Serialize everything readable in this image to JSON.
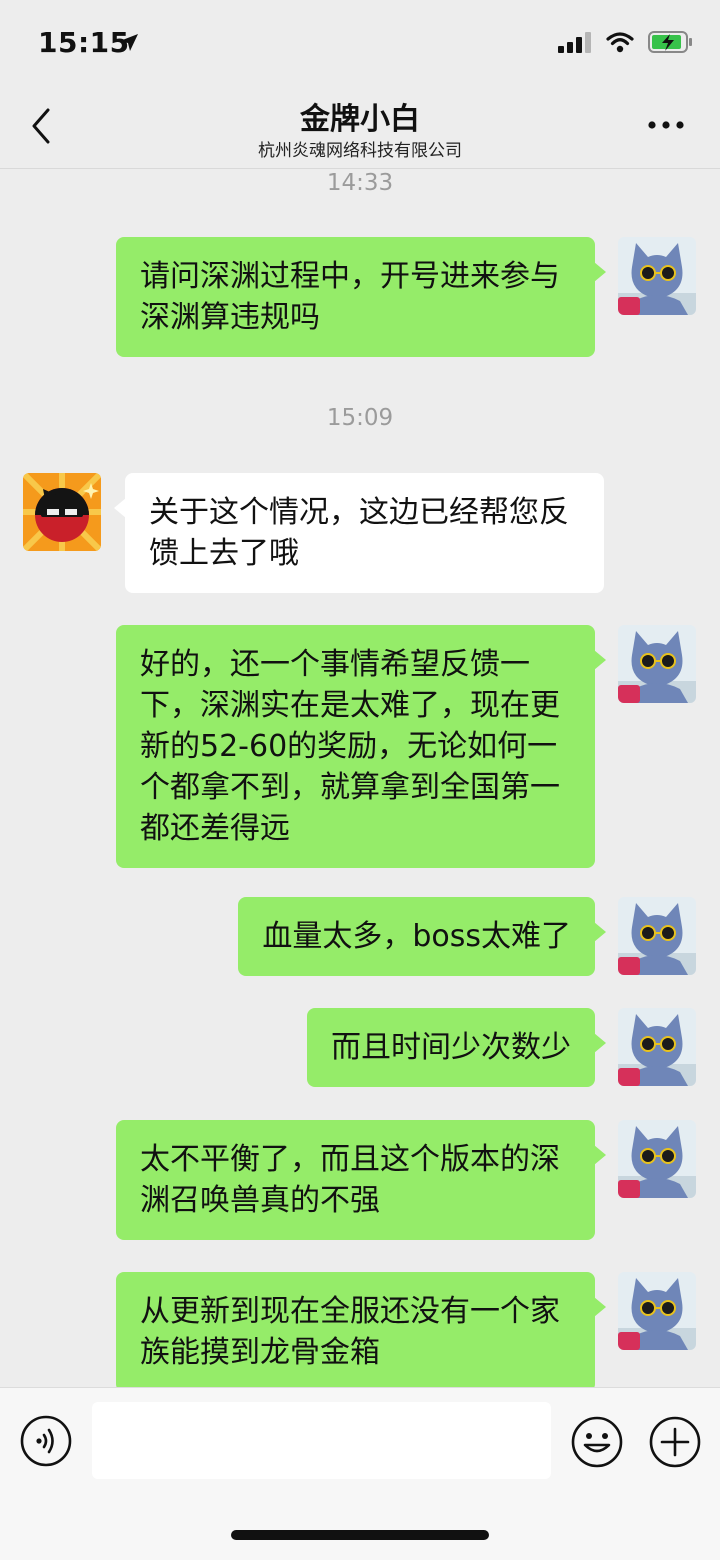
{
  "status_bar": {
    "time": "15:15"
  },
  "header": {
    "title": "金牌小白",
    "subtitle": "杭州炎魂网络科技有限公司"
  },
  "timestamps": [
    "14:33",
    "15:09"
  ],
  "messages": [
    {
      "sender": "me",
      "text": "请问深渊过程中，开号进来参与深渊算违规吗"
    },
    {
      "sender": "them",
      "text": "关于这个情况，这边已经帮您反馈上去了哦"
    },
    {
      "sender": "me",
      "text": "好的，还一个事情希望反馈一下，深渊实在是太难了，现在更新的52-60的奖励，无论如何一个都拿不到，就算拿到全国第一都还差得远"
    },
    {
      "sender": "me",
      "text": "血量太多，boss太难了"
    },
    {
      "sender": "me",
      "text": "而且时间少次数少"
    },
    {
      "sender": "me",
      "text": "太不平衡了，而且这个版本的深渊召唤兽真的不强"
    },
    {
      "sender": "me",
      "text": "从更新到现在全服还没有一个家族能摸到龙骨金箱"
    }
  ],
  "icons": {
    "back": "chevron-left-icon",
    "more": "more-icon",
    "voice": "voice-icon",
    "emoji": "emoji-icon",
    "add": "plus-icon"
  },
  "colors": {
    "my_bubble": "#95ec69",
    "their_bubble": "#ffffff",
    "background": "#ededed"
  }
}
